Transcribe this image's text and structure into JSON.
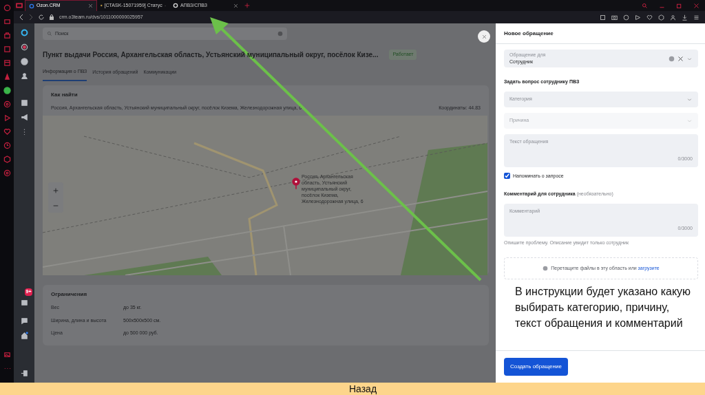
{
  "browser": {
    "tabs": [
      {
        "label": "Ozon.CRM",
        "selected": true
      },
      {
        "label": "[CTASK-15071959] Статус",
        "selected": false
      },
      {
        "label": "АПВЗ/СПВЗ",
        "selected": false
      }
    ],
    "address": "crm.o3team.ru/dvs/1011000000025957"
  },
  "app": {
    "search": {
      "placeholder": "Поиск"
    },
    "inbox_badge": "9+"
  },
  "page": {
    "title": "Пункт выдачи Россия, Архангельская область, Устьянский муниципальный округ, посёлок Кизе...",
    "status": "Работает",
    "tabs": [
      {
        "label": "Информация о ПВЗ",
        "selected": true
      },
      {
        "label": "История обращений",
        "selected": false
      },
      {
        "label": "Коммуникации",
        "selected": false
      }
    ],
    "location": {
      "heading": "Как найти",
      "address": "Россия, Архангельская область, Устьянский муниципальный округ, посёлок Кизема, Железнодорожная улица, 6",
      "coordinates": "Координаты: 44.83",
      "pin_label": "Россия, Архангельская область, Устьянский муниципальный округ, посёлок Кизема, Железнодорожная улица, 6"
    },
    "limits": {
      "heading": "Ограничения",
      "rows": [
        {
          "label": "Вес",
          "value": "до 35 кг."
        },
        {
          "label": "Ширина, длина и высота",
          "value": "500x500x500 см."
        },
        {
          "label": "Цена",
          "value": "до 500 000 руб."
        }
      ]
    }
  },
  "panel": {
    "title": "Новое обращение",
    "recipient": {
      "label": "Обращение для",
      "value": "Сотрудник"
    },
    "question_heading": "Задать вопрос сотруднику ПВЗ",
    "selects": [
      {
        "placeholder": "Категория",
        "disabled": false
      },
      {
        "placeholder": "Причина",
        "disabled": true
      }
    ],
    "message": {
      "placeholder": "Текст обращения",
      "counter": "0/3000"
    },
    "reminder": {
      "label": "Напоминать о запросе",
      "checked": true
    },
    "comment_heading": "Комментарий для сотрудника",
    "comment_optional": "(необязательно)",
    "comment": {
      "placeholder": "Комментарий",
      "counter": "0/3000"
    },
    "comment_hint": "Опишите проблему. Описание увидит только сотрудник",
    "dropzone": {
      "text": "Перетащите файлы в эту область или",
      "link": "загрузите"
    },
    "submit": "Создать обращение"
  },
  "annotation": "В инструкции будет указано какую выбирать категорию, причину, текст обращения и комментарий",
  "footer": "Назад"
}
